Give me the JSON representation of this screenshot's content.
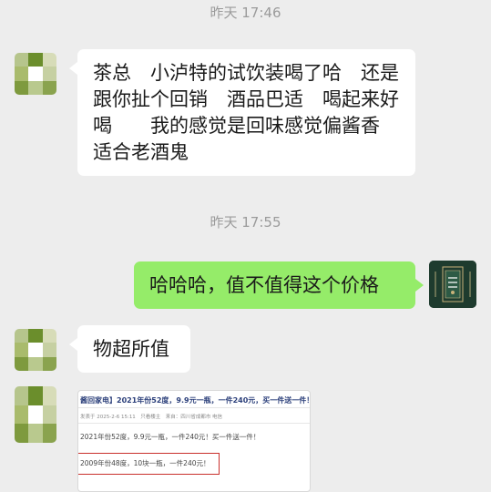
{
  "chat": {
    "time1": "昨天 17:46",
    "msg1": "茶总　小泸特的试饮装喝了哈　还是跟你扯个回销　酒品巴适　喝起来好喝　　我的感觉是回味感觉偏酱香　 适合老酒鬼",
    "time2": "昨天 17:55",
    "msg2": "哈哈哈，值不值得这个价格",
    "msg3": "物超所值"
  },
  "shared_image": {
    "title": "酱回家电】2021年份52度，9.9元一瓶，一件240元，买一件送一件！",
    "meta": "发表于 2025-2-6 15:11　只看楼主　来自：四川省成都市 电信",
    "line1": "2021年份52度，9.9元一瓶，一件240元！买一件送一件！",
    "line2": "2009年份48度，10块一瓶，一件240元！"
  },
  "colors": {
    "background": "#ededed",
    "bubble_self": "#95ec69",
    "bubble_other": "#ffffff",
    "highlight_box": "#c9302c"
  }
}
